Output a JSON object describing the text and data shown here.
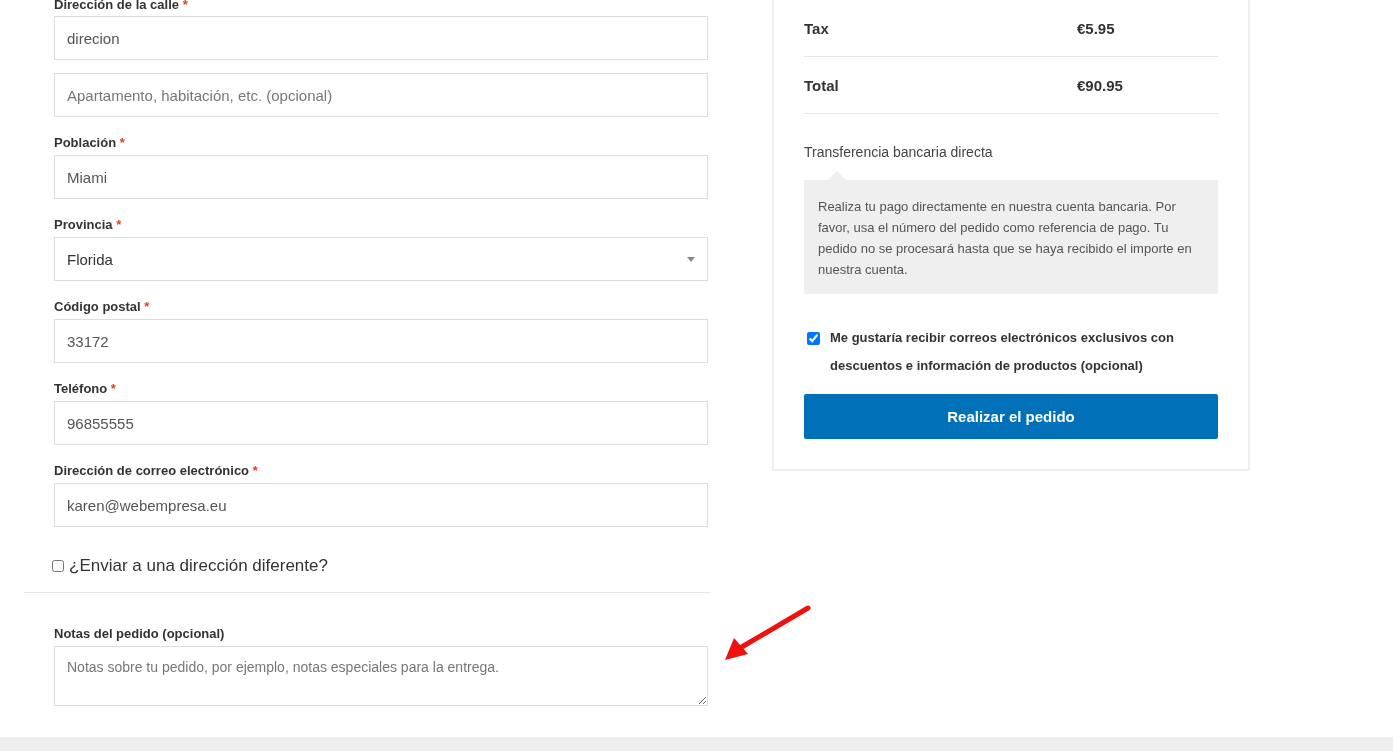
{
  "billing_fields": [
    {
      "kind": "text",
      "label": "Dirección de la calle",
      "required_mark": "*",
      "value": "direcion"
    },
    {
      "kind": "text",
      "placeholder": "Apartamento, habitación, etc. (opcional)"
    },
    {
      "kind": "text",
      "label": "Población",
      "required_mark": "*",
      "value": "Miami"
    },
    {
      "kind": "select",
      "label": "Provincia",
      "required_mark": "*",
      "value": "Florida"
    },
    {
      "kind": "text",
      "label": "Código postal",
      "required_mark": "*",
      "value": "33172"
    },
    {
      "kind": "text",
      "label": "Teléfono",
      "required_mark": "*",
      "value": "96855555"
    },
    {
      "kind": "text",
      "label": "Dirección de correo electrónico",
      "required_mark": "*",
      "value": "karen@webempresa.eu"
    }
  ],
  "ship_different": {
    "label": "¿Enviar a una dirección diferente?",
    "checked": false
  },
  "order_notes": {
    "label": "Notas del pedido (opcional)",
    "placeholder": "Notas sobre tu pedido, por ejemplo, notas especiales para la entrega."
  },
  "order_summary": {
    "rows": [
      {
        "label": "Tax",
        "amount": "€5.95"
      },
      {
        "label": "Total",
        "amount": "€90.95"
      }
    ],
    "payment_method": "Transferencia bancaria directa",
    "payment_description": "Realiza tu pago directamente en nuestra cuenta bancaria. Por favor, usa el número del pedido como referencia de pago. Tu pedido no se procesará hasta que se haya recibido el importe en nuestra cuenta.",
    "newsletter": {
      "label": "Me gustaría recibir correos electrónicos exclusivos con descuentos e información de productos (opcional)",
      "checked": true
    },
    "place_order_button": "Realizar el pedido"
  }
}
